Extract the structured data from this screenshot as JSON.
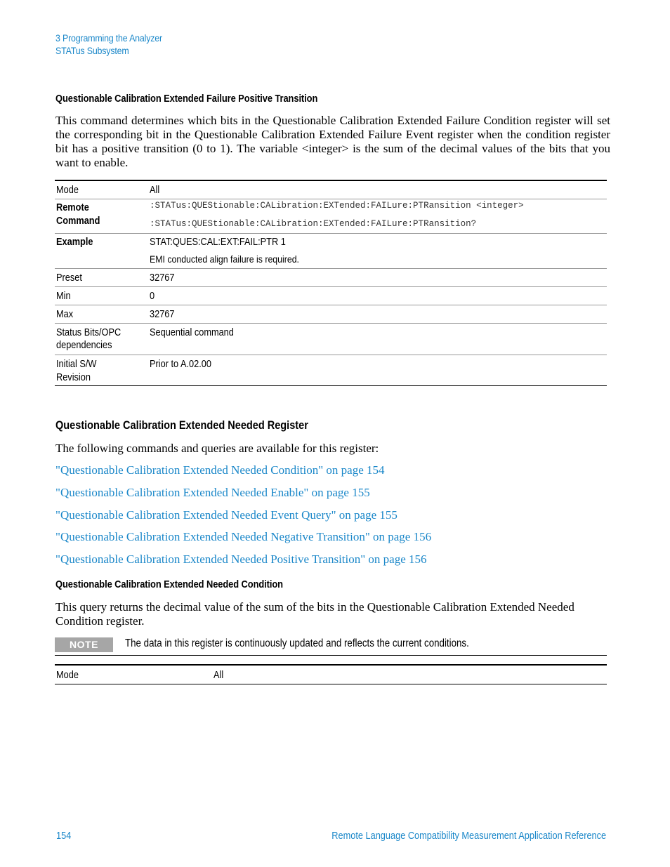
{
  "header": {
    "chapter": "3  Programming the Analyzer",
    "section": "STATus Subsystem"
  },
  "ptr_section": {
    "title": "Questionable Calibration Extended Failure Positive Transition",
    "description": "This command determines which bits in the Questionable Calibration Extended Failure Condition register will set the corresponding bit in the Questionable Calibration Extended Failure Event register when the condition register bit has a positive transition (0 to 1). The variable <integer> is the sum of the decimal values of the bits that you want to enable.",
    "table": {
      "mode_label": "Mode",
      "mode_value": "All",
      "remote_label_1": "Remote",
      "remote_label_2": "Command",
      "remote_cmd": ":STATus:QUEStionable:CALibration:EXTended:FAILure:PTRansition <integer>",
      "remote_query": ":STATus:QUEStionable:CALibration:EXTended:FAILure:PTRansition?",
      "example_label": "Example",
      "example_cmd": "STAT:QUES:CAL:EXT:FAIL:PTR 1",
      "example_note": "EMI conducted align failure is required.",
      "preset_label": "Preset",
      "preset_value": "32767",
      "min_label": "Min",
      "min_value": "0",
      "max_label": "Max",
      "max_value": "32767",
      "status_label_1": "Status Bits/OPC",
      "status_label_2": "dependencies",
      "status_value": "Sequential command",
      "initial_label_1": "Initial S/W",
      "initial_label_2": "Revision",
      "initial_value": "Prior to A.02.00"
    }
  },
  "needed_register": {
    "title": "Questionable Calibration Extended Needed Register",
    "intro": "The following commands and queries are available for this register:",
    "links": [
      "\"Questionable Calibration Extended Needed Condition\" on page 154",
      "\"Questionable Calibration Extended Needed Enable\" on page 155",
      "\"Questionable Calibration Extended Needed Event Query\" on page 155",
      "\"Questionable Calibration Extended Needed Negative Transition\" on page 156",
      "\"Questionable Calibration Extended Needed Positive Transition\" on page 156"
    ]
  },
  "needed_condition": {
    "title": "Questionable Calibration Extended Needed Condition",
    "description": "This query returns the decimal value of the sum of the bits in the Questionable Calibration Extended Needed Condition register.",
    "note_badge": "NOTE",
    "note_text": "The data in this register is continuously updated and reflects the current conditions.",
    "mode_label": "Mode",
    "mode_value": "All"
  },
  "footer": {
    "page_number": "154",
    "book_title": "Remote Language Compatibility Measurement Application Reference"
  },
  "colors": {
    "link": "#1a87c9",
    "note_badge": "#a6a6a6"
  }
}
